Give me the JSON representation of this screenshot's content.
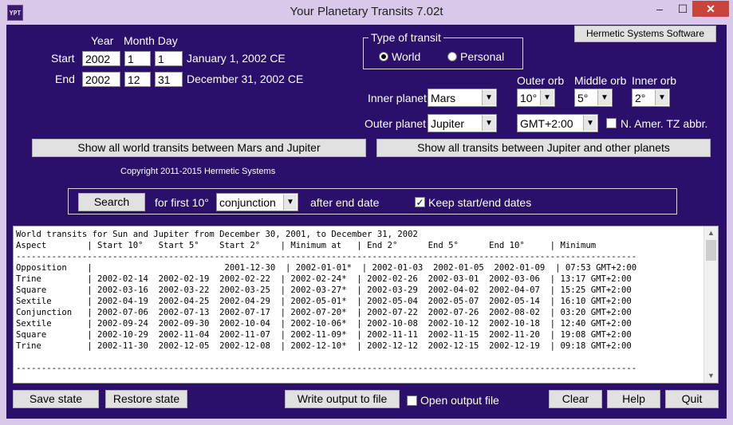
{
  "window": {
    "icon_text": "YPT",
    "title": "Your Planetary Transits 7.02t",
    "minimize": "–",
    "maximize": "☐",
    "close": "✕"
  },
  "dates": {
    "year_header": "Year",
    "month_day_header": "Month Day",
    "start_label": "Start",
    "start_year": "2002",
    "start_month": "1",
    "start_day": "1",
    "start_text": "January 1, 2002 CE",
    "end_label": "End",
    "end_year": "2002",
    "end_month": "12",
    "end_day": "31",
    "end_text": "December 31, 2002 CE"
  },
  "transit_type": {
    "title": "Type of transit",
    "world_label": "World",
    "personal_label": "Personal",
    "selected": "World"
  },
  "hermetic_button": "Hermetic Systems Software",
  "planets": {
    "inner_label": "Inner planet",
    "inner_value": "Mars",
    "outer_label": "Outer planet",
    "outer_value": "Jupiter",
    "outer_orb_label": "Outer orb",
    "outer_orb_value": "10°",
    "middle_orb_label": "Middle orb",
    "middle_orb_value": "5°",
    "inner_orb_label": "Inner orb",
    "inner_orb_value": "2°",
    "timezone_value": "GMT+2:00",
    "tz_abbr_label": "N. Amer. TZ abbr.",
    "tz_abbr_checked": false
  },
  "show_buttons": {
    "world": "Show all world transits between Mars and Jupiter",
    "others": "Show all transits between Jupiter and other planets"
  },
  "copyright": "Copyright 2011-2015 Hermetic Systems",
  "search": {
    "button": "Search",
    "for_first": "for first 10°",
    "aspect_value": "conjunction",
    "after_end": "after end date",
    "keep_label": "Keep start/end dates",
    "keep_checked": true
  },
  "output_lines": [
    "World transits for Sun and Jupiter from December 30, 2001, to December 31, 2002",
    "Aspect        | Start 10°   Start 5°    Start 2°    | Minimum at   | End 2°      End 5°      End 10°     | Minimum",
    "--------------------------------------------------------------------------------------------------------------------------",
    "Opposition    |                          2001-12-30  | 2002-01-01*  | 2002-01-03  2002-01-05  2002-01-09  | 07:53 GMT+2:00",
    "Trine         | 2002-02-14  2002-02-19  2002-02-22  | 2002-02-24*  | 2002-02-26  2002-03-01  2002-03-06  | 13:17 GMT+2:00",
    "Square        | 2002-03-16  2002-03-22  2002-03-25  | 2002-03-27*  | 2002-03-29  2002-04-02  2002-04-07  | 15:25 GMT+2:00",
    "Sextile       | 2002-04-19  2002-04-25  2002-04-29  | 2002-05-01*  | 2002-05-04  2002-05-07  2002-05-14  | 16:10 GMT+2:00",
    "Conjunction   | 2002-07-06  2002-07-13  2002-07-17  | 2002-07-20*  | 2002-07-22  2002-07-26  2002-08-02  | 03:20 GMT+2:00",
    "Sextile       | 2002-09-24  2002-09-30  2002-10-04  | 2002-10-06*  | 2002-10-08  2002-10-12  2002-10-18  | 12:40 GMT+2:00",
    "Square        | 2002-10-29  2002-11-04  2002-11-07  | 2002-11-09*  | 2002-11-11  2002-11-15  2002-11-20  | 19:08 GMT+2:00",
    "Trine         | 2002-11-30  2002-12-05  2002-12-08  | 2002-12-10*  | 2002-12-12  2002-12-15  2002-12-19  | 09:18 GMT+2:00",
    "",
    "--------------------------------------------------------------------------------------------------------------------------"
  ],
  "bottom": {
    "save_state": "Save state",
    "restore_state": "Restore state",
    "write_output": "Write output to file",
    "open_output_label": "Open output file",
    "open_output_checked": false,
    "clear": "Clear",
    "help": "Help",
    "quit": "Quit"
  }
}
